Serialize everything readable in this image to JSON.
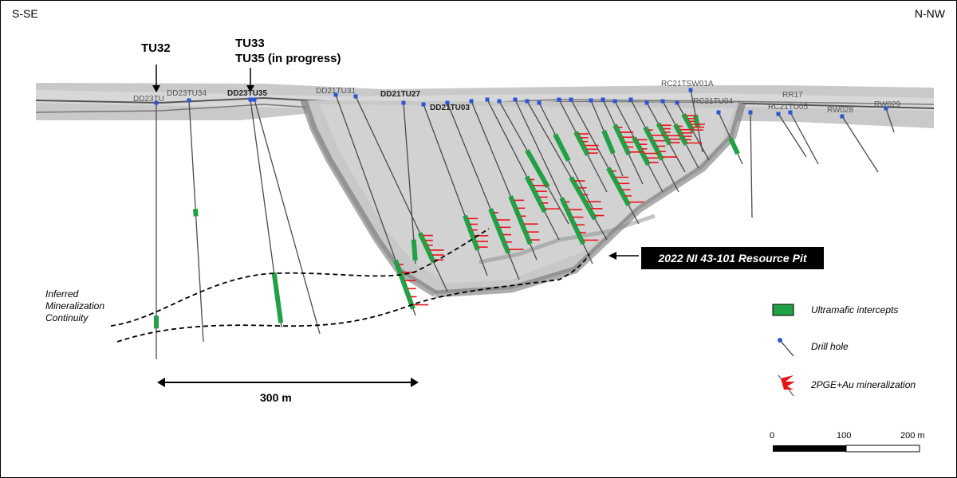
{
  "orientation": {
    "left": "S-SE",
    "right": "N-NW"
  },
  "callouts": {
    "tu32": "TU32",
    "tu33_line1": "TU33",
    "tu33_line2": "TU35 (in progress)"
  },
  "pit_label": "2022 NI 43-101 Resource Pit",
  "inferred": {
    "line1": "Inferred",
    "line2": "Mineralization",
    "line3": "Continuity"
  },
  "distance_label": "300 m",
  "legend": {
    "ultramafic": "Ultramafic intercepts",
    "drill_hole": "Drill hole",
    "mineralization": "2PGE+Au mineralization"
  },
  "scale_bar": {
    "zero": "0",
    "mid": "100",
    "end": "200 m"
  },
  "colors": {
    "ultramafic": "#22a045",
    "mineralization": "#e8141a",
    "collar": "#2b55d6",
    "pit_fill": "#c8c8c8"
  },
  "hole_labels": {
    "dd23tu3x": "DD23TU",
    "dd23tu34": "DD23TU34",
    "dd23tu35": "DD23TU35",
    "dd21tu31": "DD21TU31",
    "dd21tu27": "DD21TU27",
    "dd21tu03": "DD21TU03",
    "rc21tsw01a": "RC21TSW01A",
    "rc21tu04": "RC21TU04",
    "rc21tu05": "RC21TU05",
    "rr17": "RR17",
    "rw028": "RW028",
    "rw029": "RW029"
  }
}
